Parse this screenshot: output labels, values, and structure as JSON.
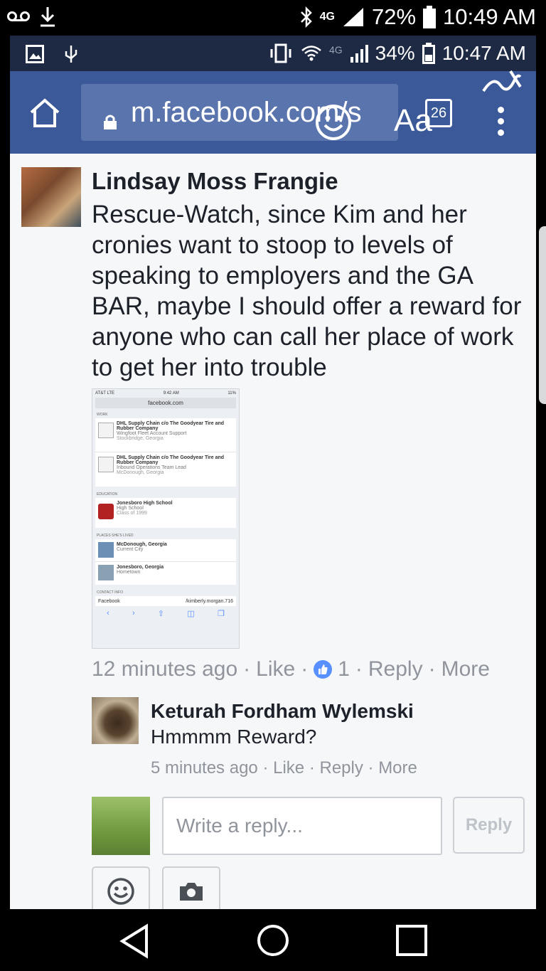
{
  "outer_status": {
    "battery": "72%",
    "time": "10:49 AM",
    "network": "4G"
  },
  "inner_status": {
    "network": "4G",
    "battery": "34%",
    "time": "10:47 AM"
  },
  "browser": {
    "url": "m.facebook.com/s",
    "tab_count": "26",
    "text_size_label": "Aa"
  },
  "comment": {
    "author": "Lindsay Moss Frangie",
    "text": "Rescue-Watch, since Kim and her cronies want to stoop to levels of speaking to employers and the GA BAR, maybe I should offer a reward for anyone who can call her place of work to get her into trouble",
    "time": "12 minutes ago",
    "like": "Like",
    "reactions": "1",
    "reply": "Reply",
    "more": "More"
  },
  "screenshot": {
    "carrier": "AT&T LTE",
    "time": "9:42 AM",
    "battery": "11%",
    "url": "facebook.com",
    "work_header": "WORK",
    "work": [
      {
        "title": "DHL Supply Chain c/o The Goodyear Tire and Rubber Company",
        "sub1": "Wingfoot Fleet Account Support",
        "sub2": "Stockbridge, Georgia"
      },
      {
        "title": "DHL Supply Chain c/o The Goodyear Tire and Rubber Company",
        "sub1": "Inbound Operations Team Lead",
        "sub2": "McDonough, Georgia"
      }
    ],
    "education_header": "EDUCATION",
    "school": "Jonesboro High School",
    "school_sub1": "High School",
    "school_sub2": "Class of 1999",
    "places_header": "PLACES SHE'S LIVED",
    "places": [
      {
        "title": "McDonough, Georgia",
        "sub": "Current City"
      },
      {
        "title": "Jonesboro, Georgia",
        "sub": "Hometown"
      }
    ],
    "contact_header": "CONTACT INFO",
    "contact_label": "Facebook",
    "contact_value": "/kimberly.morgan.716"
  },
  "reply": {
    "author": "Keturah Fordham Wylemski",
    "text": "Hmmmm Reward?",
    "time": "5 minutes ago",
    "like": "Like",
    "reply": "Reply",
    "more": "More"
  },
  "composer": {
    "placeholder": "Write a reply...",
    "button": "Reply"
  },
  "colors": {
    "facebook_blue": "#3b5998",
    "link_gray": "#90949c",
    "like_blue": "#5890ff"
  },
  "icons": [
    "voicemail-icon",
    "download-icon",
    "bluetooth-icon",
    "signal-icon",
    "battery-icon",
    "image-icon",
    "usb-icon",
    "vibrate-icon",
    "wifi-icon",
    "home-icon",
    "lock-icon",
    "smiley-icon",
    "pen-icon",
    "menu-icon",
    "like-icon",
    "camera-icon",
    "back-icon",
    "nav-home-icon",
    "recents-icon"
  ]
}
